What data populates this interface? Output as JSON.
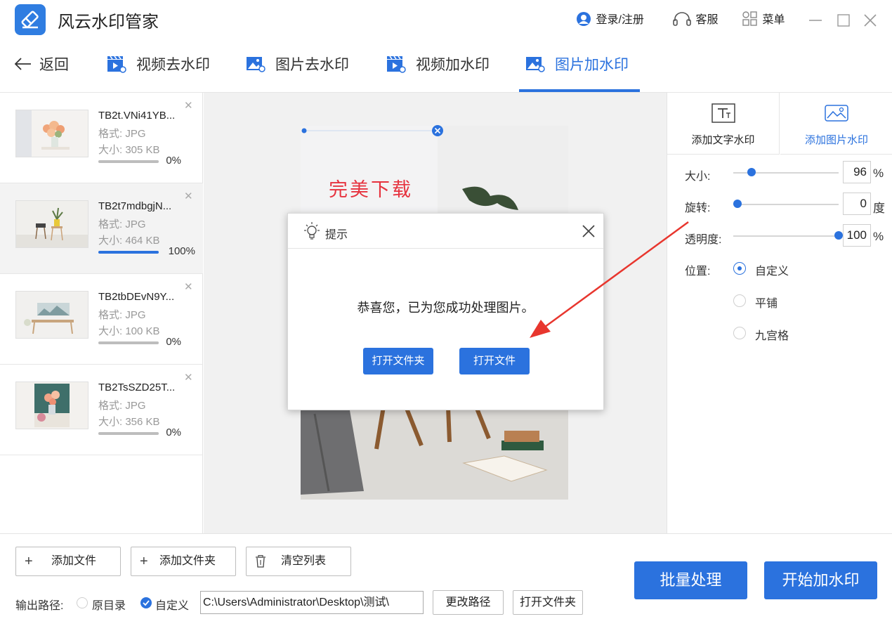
{
  "app": {
    "title": "风云水印管家",
    "login": "登录/注册",
    "service": "客服",
    "menu": "菜单"
  },
  "nav": {
    "back": "返回",
    "tabs": [
      {
        "label": "视频去水印"
      },
      {
        "label": "图片去水印"
      },
      {
        "label": "视频加水印"
      },
      {
        "label": "图片加水印"
      }
    ]
  },
  "files": [
    {
      "name": "TB2t.VNi41YB...",
      "format": "格式: JPG",
      "size": "大小: 305 KB",
      "progress": 0,
      "progress_text": "0%"
    },
    {
      "name": "TB2t7mdbgjN...",
      "format": "格式: JPG",
      "size": "大小: 464 KB",
      "progress": 100,
      "progress_text": "100%"
    },
    {
      "name": "TB2tbDEvN9Y...",
      "format": "格式: JPG",
      "size": "大小: 100 KB",
      "progress": 0,
      "progress_text": "0%"
    },
    {
      "name": "TB2TsSZD25T...",
      "format": "格式: JPG",
      "size": "大小: 356 KB",
      "progress": 0,
      "progress_text": "0%"
    }
  ],
  "preview": {
    "watermark_text": "完美下载"
  },
  "right_panel": {
    "tab_text": "添加文字水印",
    "tab_image": "添加图片水印",
    "size_label": "大小:",
    "size_value": "96",
    "size_unit": "%",
    "size_fraction": 0.14,
    "rotate_label": "旋转:",
    "rotate_value": "0",
    "rotate_unit": "度",
    "rotate_fraction": 0.0,
    "opacity_label": "透明度:",
    "opacity_value": "100",
    "opacity_unit": "%",
    "opacity_fraction": 1.0,
    "position_label": "位置:",
    "positions": [
      "自定义",
      "平铺",
      "九宫格"
    ]
  },
  "bottom": {
    "add_file": "添加文件",
    "add_folder": "添加文件夹",
    "clear_list": "清空列表",
    "output_label": "输出路径:",
    "opt_original": "原目录",
    "opt_custom": "自定义",
    "path": "C:\\Users\\Administrator\\Desktop\\测试\\",
    "change_path": "更改路径",
    "open_folder": "打开文件夹",
    "batch": "批量处理",
    "start": "开始加水印"
  },
  "dialog": {
    "title": "提示",
    "message": "恭喜您，已为您成功处理图片。",
    "open_folder": "打开文件夹",
    "open_file": "打开文件"
  },
  "colors": {
    "accent": "#2b72de",
    "watermark": "#e6323e",
    "annotation_arrow": "#e8362e"
  }
}
